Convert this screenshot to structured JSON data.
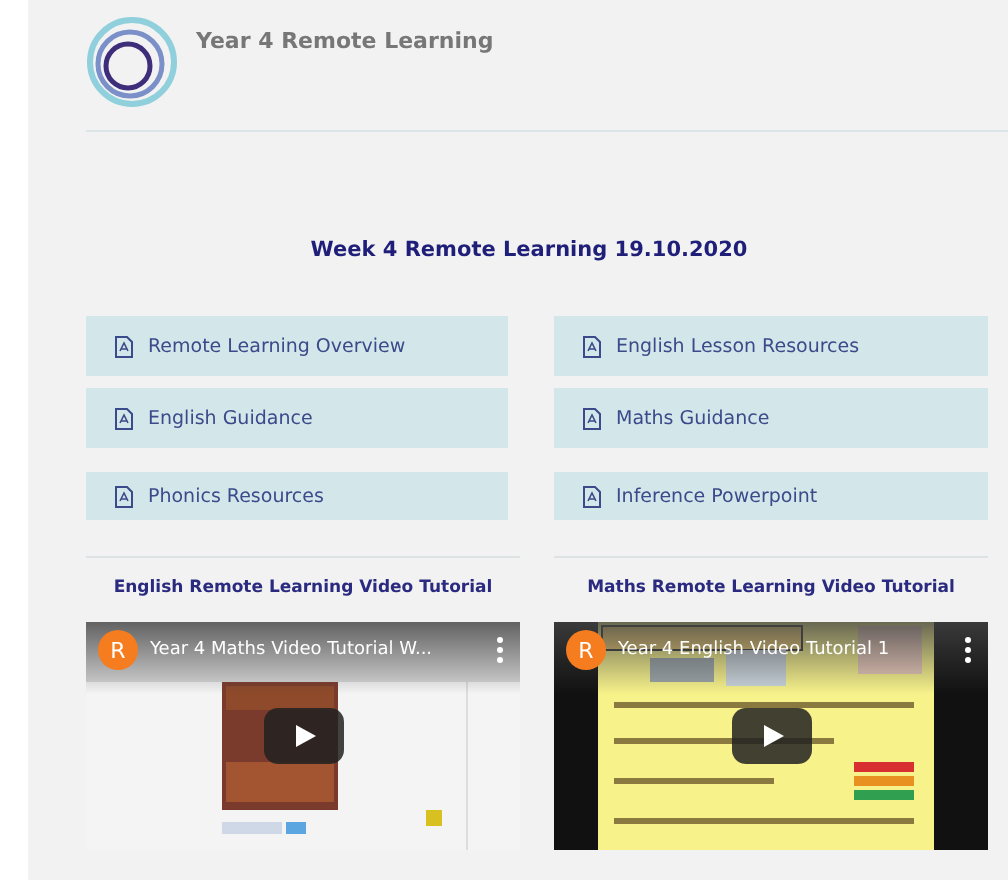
{
  "site": {
    "title": "Year 4 Remote Learning"
  },
  "heading": "Week 4 Remote Learning 19.10.2020",
  "resources": [
    {
      "label": "Remote Learning Overview"
    },
    {
      "label": "English Lesson Resources"
    },
    {
      "label": "English Guidance"
    },
    {
      "label": "Maths Guidance"
    },
    {
      "label": "Phonics Resources"
    },
    {
      "label": "Inference Powerpoint"
    }
  ],
  "videos": [
    {
      "heading": "English Remote Learning Video Tutorial",
      "title": "Year 4 Maths Video Tutorial W...",
      "channel_initial": "R",
      "kind": "picture"
    },
    {
      "heading": "Maths Remote Learning Video Tutorial",
      "title": "Year 4 English Video Tutorial 1",
      "channel_initial": "R",
      "kind": "picture"
    }
  ]
}
